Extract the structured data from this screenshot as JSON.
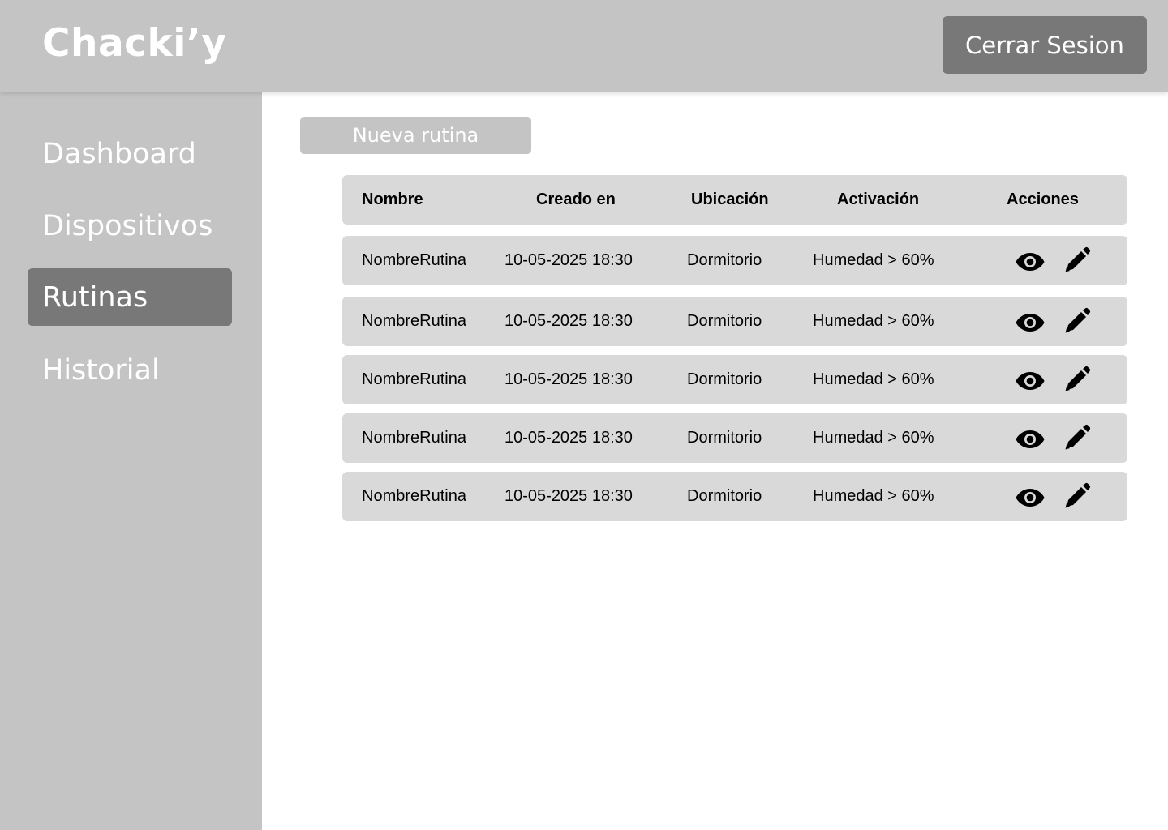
{
  "app": {
    "logo": "Chacki’y",
    "logout_label": "Cerrar Sesion"
  },
  "sidebar": {
    "items": [
      {
        "label": "Dashboard",
        "active": false
      },
      {
        "label": "Dispositivos",
        "active": false
      },
      {
        "label": "Rutinas",
        "active": true
      },
      {
        "label": "Historial",
        "active": false
      }
    ]
  },
  "main": {
    "new_button_label": "Nueva rutina",
    "table": {
      "columns": [
        "Nombre",
        "Creado en",
        "Ubicación",
        "Activación",
        "Acciones"
      ],
      "rows": [
        {
          "name": "NombreRutina",
          "created": "10-05-2025  18:30",
          "location": "Dormitorio",
          "activation": "Humedad > 60%"
        },
        {
          "name": "NombreRutina",
          "created": "10-05-2025  18:30",
          "location": "Dormitorio",
          "activation": "Humedad > 60%"
        },
        {
          "name": "NombreRutina",
          "created": "10-05-2025  18:30",
          "location": "Dormitorio",
          "activation": "Humedad > 60%"
        },
        {
          "name": "NombreRutina",
          "created": "10-05-2025  18:30",
          "location": "Dormitorio",
          "activation": "Humedad > 60%"
        },
        {
          "name": "NombreRutina",
          "created": "10-05-2025  18:30",
          "location": "Dormitorio",
          "activation": "Humedad > 60%"
        }
      ],
      "row_actions": [
        "eye-icon",
        "pencil-icon"
      ]
    }
  },
  "colors": {
    "sidebar_bg": "#c4c4c4",
    "active_bg": "#787878",
    "row_bg": "#d9d9d9",
    "text_light": "#ffffff",
    "text_dark": "#000000"
  }
}
